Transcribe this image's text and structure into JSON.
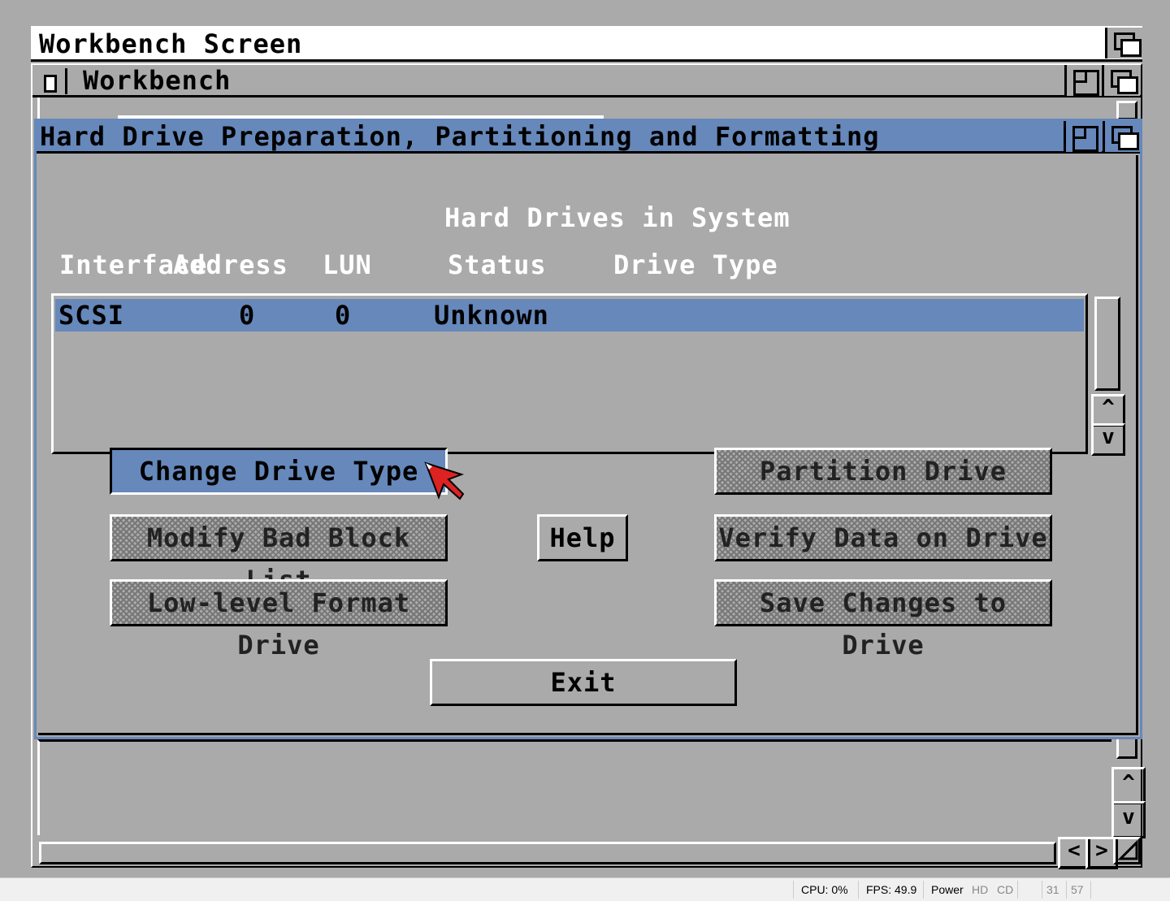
{
  "screen": {
    "title": "Workbench Screen"
  },
  "workbench_window": {
    "title": "Workbench"
  },
  "hd_window": {
    "title": "Hard Drive Preparation, Partitioning and Formatting",
    "list_title": "Hard Drives in System",
    "columns": {
      "interface": "Interface",
      "address": "Address",
      "lun": "LUN",
      "status": "Status",
      "drive_type": "Drive Type"
    },
    "drives": [
      {
        "interface": "SCSI",
        "address": "0",
        "lun": "0",
        "status": "Unknown",
        "drive_type": ""
      }
    ],
    "buttons": {
      "change_drive_type": "Change Drive Type",
      "modify_bad_block_list": "Modify Bad Block List",
      "low_level_format": "Low-level Format Drive",
      "help": "Help",
      "partition_drive": "Partition Drive",
      "verify_data": "Verify Data on Drive",
      "save_changes": "Save Changes to Drive",
      "exit": "Exit"
    },
    "colors": {
      "title_bar": "#6688bb",
      "background": "#aaaaaa",
      "highlight": "#6688bb"
    }
  },
  "scroll_arrows": {
    "up": "^",
    "down": "v",
    "left": "<",
    "right": ">"
  },
  "status_bar": {
    "cpu": "CPU: 0%",
    "fps": "FPS: 49.9",
    "power": "Power",
    "hd": "HD",
    "cd": "CD",
    "df0": "31",
    "df1": "57"
  }
}
